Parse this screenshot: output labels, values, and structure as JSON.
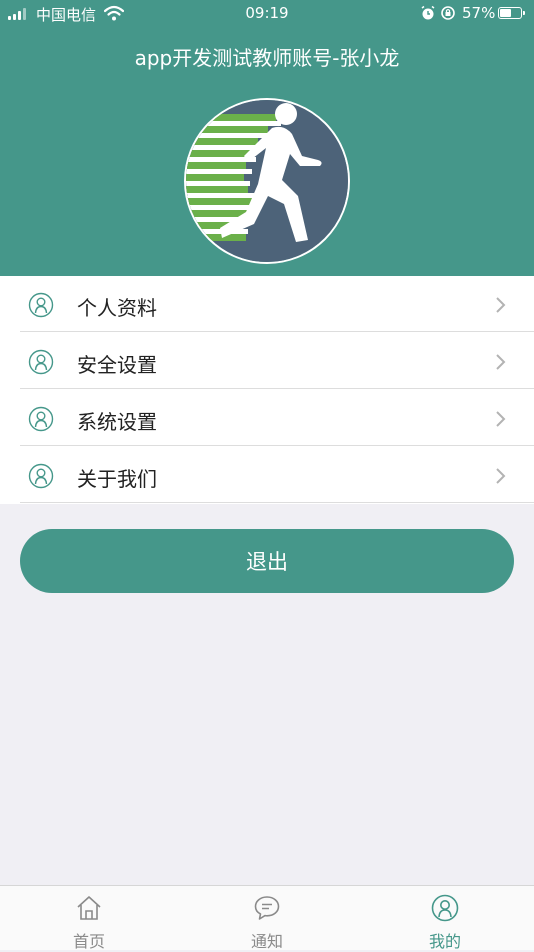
{
  "status_bar": {
    "carrier": "中国电信",
    "time": "09:19",
    "battery_percent": "57%",
    "battery_level": 0.57
  },
  "header": {
    "title": "app开发测试教师账号-张小龙"
  },
  "colors": {
    "primary": "#45978a",
    "background": "#f0eff4",
    "avatar_bg": "#4d6379",
    "avatar_stripes": "#6bb04a"
  },
  "menu": {
    "items": [
      {
        "label": "个人资料",
        "icon": "user-circle-icon"
      },
      {
        "label": "安全设置",
        "icon": "user-circle-icon"
      },
      {
        "label": "系统设置",
        "icon": "user-circle-icon"
      },
      {
        "label": "关于我们",
        "icon": "user-circle-icon"
      }
    ]
  },
  "logout": {
    "label": "退出"
  },
  "tabbar": {
    "tabs": [
      {
        "label": "首页",
        "icon": "home-icon",
        "active": false
      },
      {
        "label": "通知",
        "icon": "chat-bubble-icon",
        "active": false
      },
      {
        "label": "我的",
        "icon": "user-circle-icon",
        "active": true
      }
    ]
  }
}
